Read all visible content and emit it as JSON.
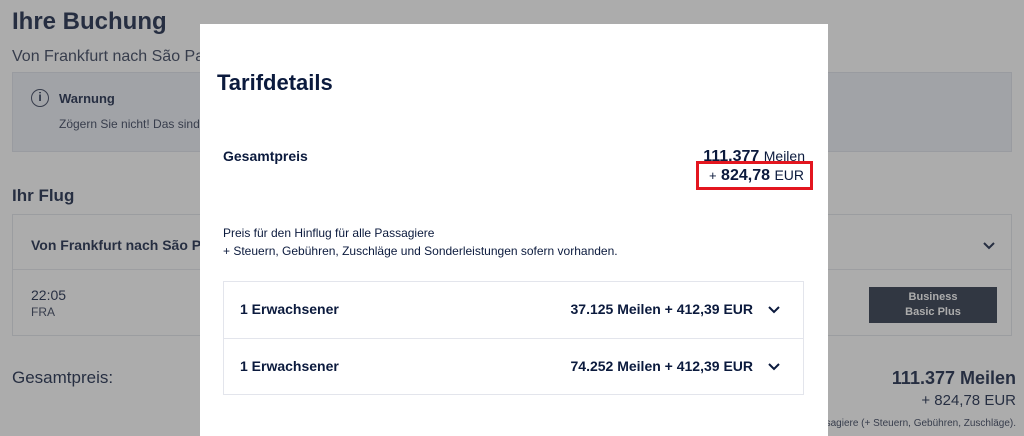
{
  "background": {
    "title": "Ihre Buchung",
    "route": "Von Frankfurt nach São Pa",
    "warning": {
      "icon": "info-icon",
      "title": "Warnung",
      "text": "Zögern Sie nicht! Das sind"
    },
    "flight_heading": "Ihr Flug",
    "flight": {
      "route": "Von Frankfurt nach São Pa",
      "time": "22:05",
      "airport": "FRA",
      "cabin_line1": "Business",
      "cabin_line2": "Basic Plus"
    },
    "total_label": "Gesamtpreis:",
    "total_miles": "111.377 Meilen",
    "total_eur": "+ 824,78 EUR",
    "footnote": "ssagiere (+ Steuern, Gebühren, Zuschläge)."
  },
  "modal": {
    "title": "Tarifdetails",
    "total_label": "Gesamtpreis",
    "total_miles_value": "111.377",
    "miles_unit": "Meilen",
    "plus": "+",
    "total_eur_value": "824,78",
    "eur_unit": "EUR",
    "highlight_color": "#e3161f",
    "note_line1": "Preis für den Hinflug für alle Passagiere",
    "note_line2": "+ Steuern, Gebühren, Zuschläge und Sonderleistungen sofern vorhanden.",
    "passengers": [
      {
        "label": "1 Erwachsener",
        "price": "37.125 Meilen + 412,39 EUR"
      },
      {
        "label": "1 Erwachsener",
        "price": "74.252 Meilen + 412,39 EUR"
      }
    ]
  },
  "colors": {
    "navy_text": "#0b1a3d",
    "overlay": "rgba(70,70,70,0.45)",
    "cabin_badge": "#1f2a3e"
  }
}
